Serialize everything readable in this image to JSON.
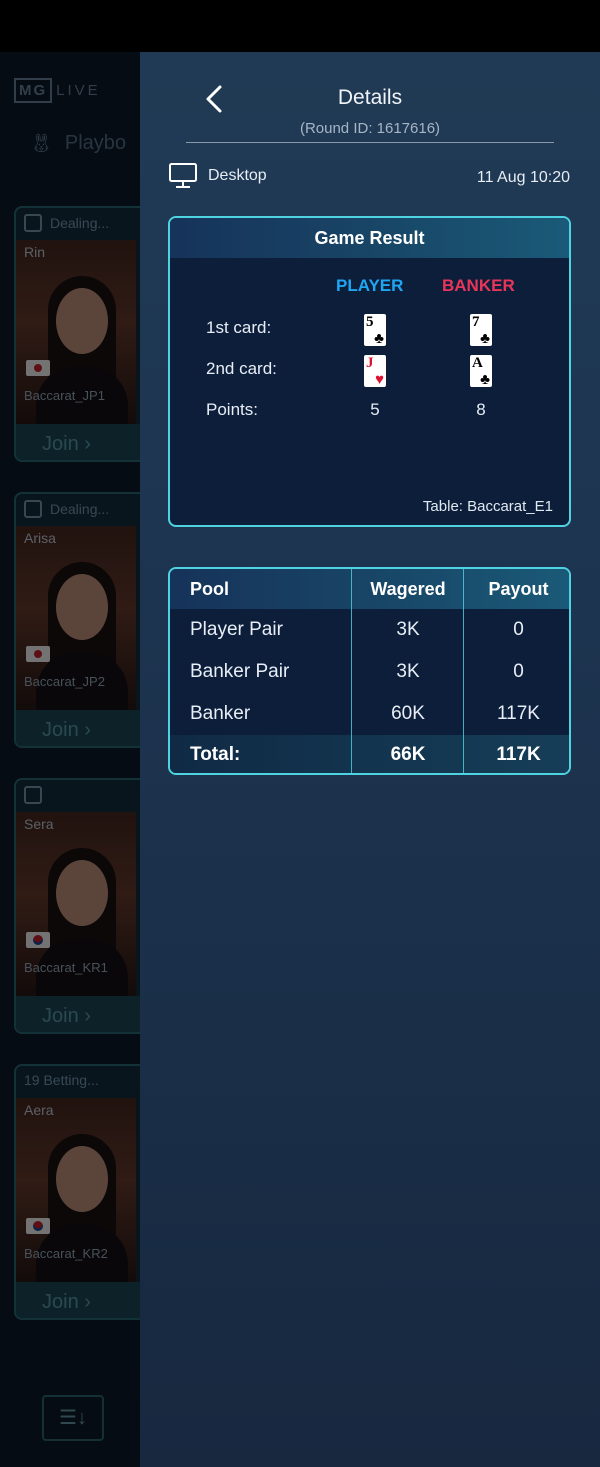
{
  "background_app": {
    "logo_mg": "MG",
    "logo_live": "LIVE",
    "category": "Playbo",
    "tables": [
      {
        "status": "Dealing...",
        "dealer": "Rin",
        "flag": "jp",
        "table": "Baccarat_JP1",
        "join": "Join ›"
      },
      {
        "status": "Dealing...",
        "dealer": "Arisa",
        "flag": "jp",
        "table": "Baccarat_JP2",
        "join": "Join ›"
      },
      {
        "status": "",
        "dealer": "Sera",
        "flag": "kr",
        "table": "Baccarat_KR1",
        "join": "Join ›"
      },
      {
        "status": "19  Betting...",
        "dealer": "Aera",
        "flag": "kr",
        "table": "Baccarat_KR2",
        "join": "Join ›"
      }
    ],
    "sort_icon": "sort-icon"
  },
  "details": {
    "title": "Details",
    "round_id": "(Round ID: 1617616)",
    "device": "Desktop",
    "datetime": "11 Aug 10:20",
    "game_result": {
      "heading": "Game Result",
      "player_label": "PLAYER",
      "banker_label": "BANKER",
      "row1_label": "1st card:",
      "row2_label": "2nd card:",
      "row3_label": "Points:",
      "player_cards": [
        {
          "rank": "5",
          "suit": "♣",
          "color": "#000000"
        },
        {
          "rank": "J",
          "suit": "♥",
          "color": "#e01030"
        }
      ],
      "banker_cards": [
        {
          "rank": "7",
          "suit": "♣",
          "color": "#000000"
        },
        {
          "rank": "A",
          "suit": "♣",
          "color": "#000000"
        }
      ],
      "player_points": "5",
      "banker_points": "8",
      "table": "Table: Baccarat_E1"
    },
    "pool": {
      "headers": [
        "Pool",
        "Wagered",
        "Payout"
      ],
      "rows": [
        [
          "Player Pair",
          "3K",
          "0"
        ],
        [
          "Banker Pair",
          "3K",
          "0"
        ],
        [
          "Banker",
          "60K",
          "117K"
        ]
      ],
      "total": [
        "Total:",
        "66K",
        "117K"
      ]
    }
  },
  "colors": {
    "accent_border": "#4fd3e0",
    "player": "#1fa6f2",
    "banker": "#e9355a"
  }
}
